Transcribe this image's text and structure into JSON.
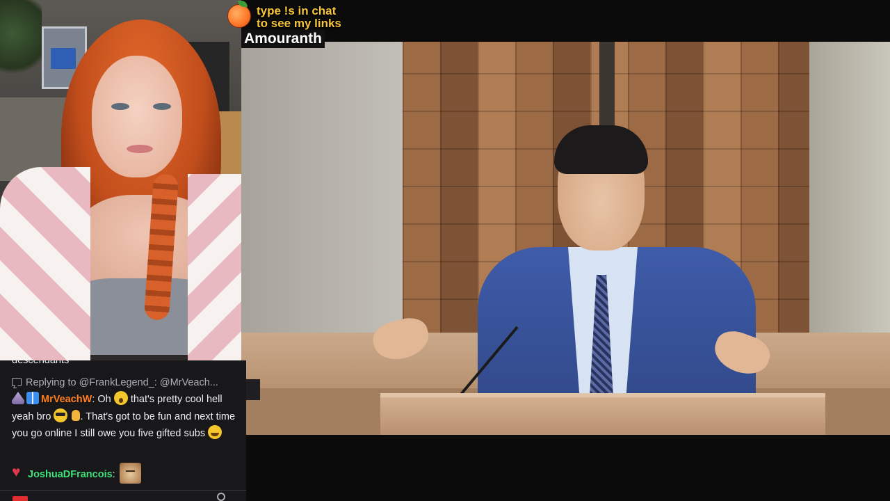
{
  "overlay": {
    "banner_line1": "type !s in chat",
    "banner_line2": "to see my links",
    "streamer_name": "Amouranth",
    "icon": "peach-icon"
  },
  "chat": {
    "clipped_text": "descendants",
    "reply": {
      "text": "Replying to @FrankLegend_: @MrVeach..."
    },
    "messages": [
      {
        "badges": [
          "hat-badge",
          "gift-badge"
        ],
        "username": "MrVeachW",
        "username_color": "#ff7f1f",
        "text_a": ": Oh",
        "text_b": "that's pretty cool hell yeah bro",
        "text_c": ". That's got to be fun and next time you go online I still owe you five gifted subs",
        "emojis": [
          "astonished-emoji",
          "sunglasses-emoji",
          "ok-hand-emoji",
          "laughing-emoji"
        ]
      },
      {
        "badges": [
          "heart-badge"
        ],
        "username": "JoshuaDFrancois",
        "username_color": "#3ee07a",
        "text": ":",
        "emote": "cat-emote"
      }
    ]
  },
  "colors": {
    "chat_background": "#18181b",
    "banner_text": "#f7c53b",
    "page_background": "#0b0b0c"
  }
}
